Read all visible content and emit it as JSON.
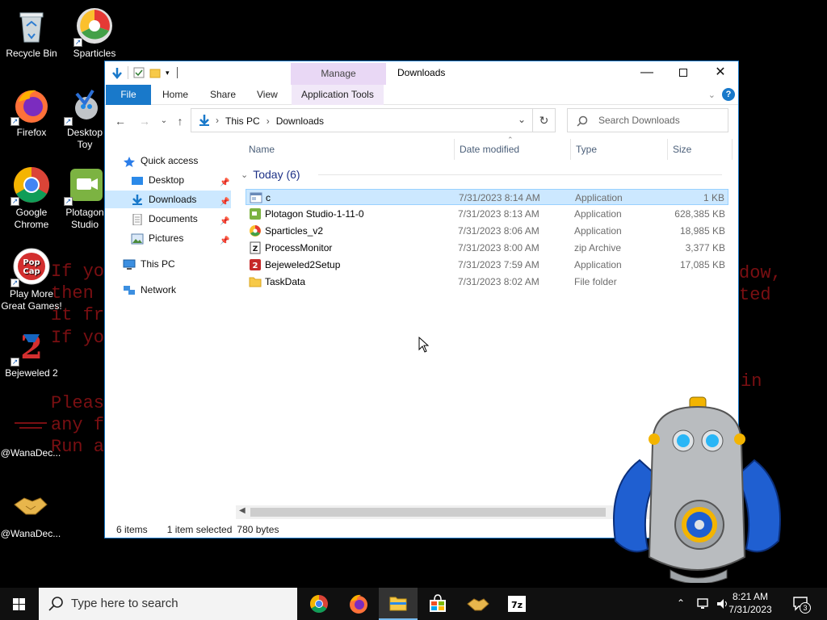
{
  "desktop": {
    "icons": [
      {
        "label": "Recycle Bin",
        "icon": "recycle-bin-icon"
      },
      {
        "label": "Sparticles",
        "icon": "sparticles-icon"
      },
      {
        "label": "Firefox",
        "icon": "firefox-icon"
      },
      {
        "label": "Desktop Toy",
        "icon": "desktop-toy-icon"
      },
      {
        "label": "Google Chrome",
        "icon": "chrome-icon"
      },
      {
        "label": "Plotagon Studio",
        "icon": "plotagon-icon"
      },
      {
        "label": "Play More Great Games!",
        "icon": "popcap-icon"
      },
      {
        "label": "Bejeweled 2",
        "icon": "bejeweled-icon"
      },
      {
        "label": "@WanaDec...",
        "icon": "wanadecrypt-icon"
      },
      {
        "label": "@WanaDec...",
        "icon": "handshake-icon"
      }
    ],
    "ransom_lines": [
      "If yo",
      "then ",
      "it fr",
      "If yo",
      "Pleas",
      "any f",
      "Run a"
    ],
    "ransom_right": [
      "dow,",
      "ted",
      "in"
    ]
  },
  "window": {
    "title": "Downloads",
    "manage_tab": "Manage",
    "ribbon_tabs": [
      "File",
      "Home",
      "Share",
      "View",
      "Application Tools"
    ],
    "breadcrumb": [
      "This PC",
      "Downloads"
    ],
    "search_placeholder": "Search Downloads",
    "nav": {
      "quick_access": "Quick access",
      "desktop": "Desktop",
      "downloads": "Downloads",
      "documents": "Documents",
      "pictures": "Pictures",
      "this_pc": "This PC",
      "network": "Network"
    },
    "columns": [
      "Name",
      "Date modified",
      "Type",
      "Size"
    ],
    "group_label": "Today (6)",
    "files": [
      {
        "name": "c",
        "date": "7/31/2023 8:14 AM",
        "type": "Application",
        "size": "1 KB",
        "selected": true
      },
      {
        "name": "Plotagon Studio-1-11-0",
        "date": "7/31/2023 8:13 AM",
        "type": "Application",
        "size": "628,385 KB"
      },
      {
        "name": "Sparticles_v2",
        "date": "7/31/2023 8:06 AM",
        "type": "Application",
        "size": "18,985 KB"
      },
      {
        "name": "ProcessMonitor",
        "date": "7/31/2023 8:00 AM",
        "type": "zip Archive",
        "size": "3,377 KB"
      },
      {
        "name": "Bejeweled2Setup",
        "date": "7/31/2023 7:59 AM",
        "type": "Application",
        "size": "17,085 KB"
      },
      {
        "name": "TaskData",
        "date": "7/31/2023 8:02 AM",
        "type": "File folder",
        "size": ""
      }
    ],
    "status": {
      "items": "6 items",
      "selected": "1 item selected",
      "size": "780 bytes"
    }
  },
  "taskbar": {
    "search_placeholder": "Type here to search",
    "time": "8:21 AM",
    "date": "7/31/2023",
    "notifications": "3"
  },
  "colors": {
    "accent": "#1979ca",
    "selection": "#cce8ff",
    "ransom": "#7a0f12"
  }
}
